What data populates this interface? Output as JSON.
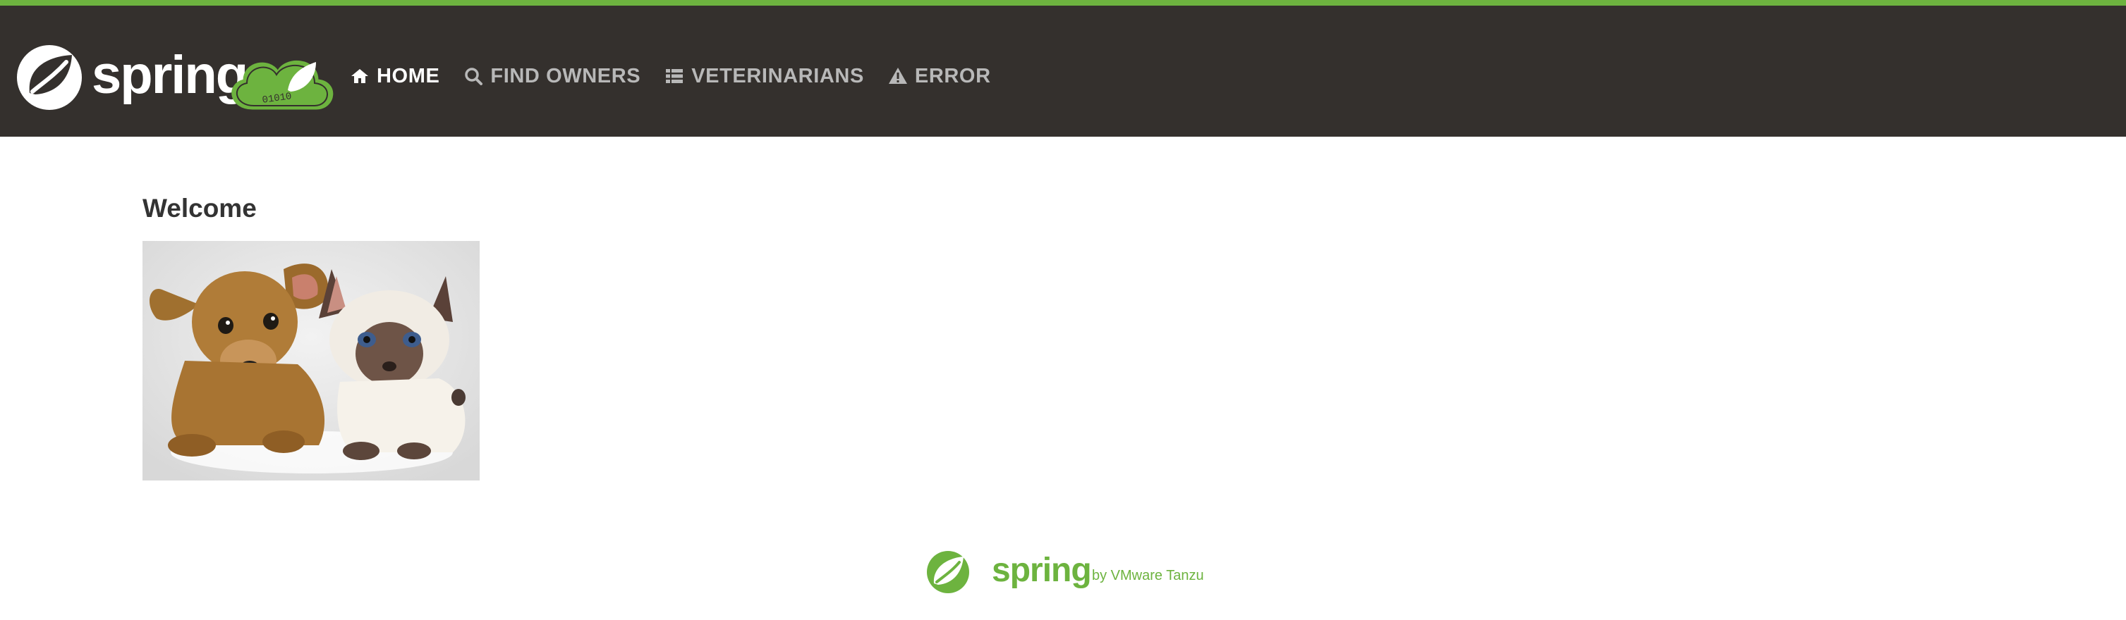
{
  "brand": {
    "wordmark": "spring",
    "badge_text": "01010"
  },
  "nav": {
    "items": [
      {
        "label": "Home",
        "icon": "home-icon",
        "active": true
      },
      {
        "label": "Find owners",
        "icon": "search-icon",
        "active": false
      },
      {
        "label": "Veterinarians",
        "icon": "list-icon",
        "active": false
      },
      {
        "label": "Error",
        "icon": "warning-icon",
        "active": false
      }
    ]
  },
  "main": {
    "title": "Welcome",
    "image": "pets-image"
  },
  "footer": {
    "wordmark": "spring",
    "tagline": "by VMware Tanzu"
  },
  "colors": {
    "accent": "#6db33f",
    "navbar": "#34302d",
    "nav_text": "#b8b8b8",
    "nav_active": "#ffffff"
  }
}
